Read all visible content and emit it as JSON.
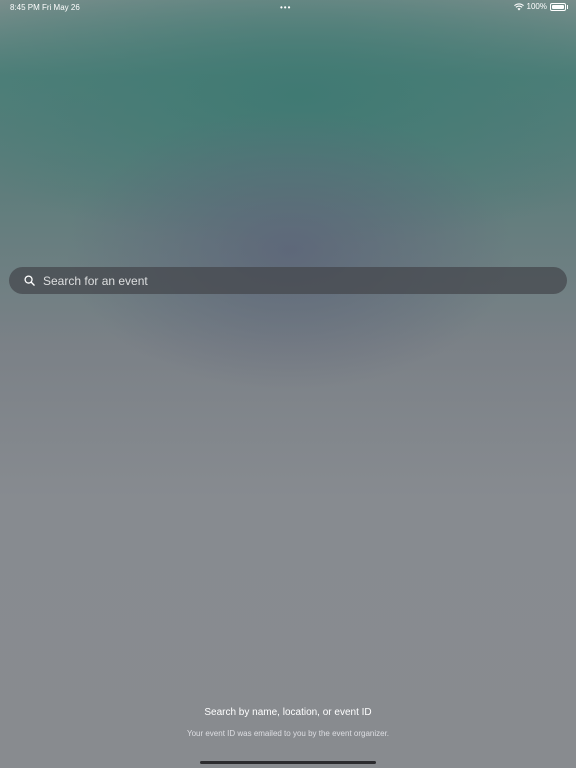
{
  "status_bar": {
    "time": "8:45 PM",
    "date": "Fri May 26",
    "dots": "•••",
    "battery": "100%"
  },
  "search": {
    "placeholder": "Search for an event"
  },
  "hint": {
    "title": "Search by name, location, or event ID",
    "subtitle": "Your event ID was emailed to you by the event organizer."
  },
  "icons": {
    "search": "search-icon",
    "wifi": "wifi-icon",
    "battery": "battery-icon"
  }
}
